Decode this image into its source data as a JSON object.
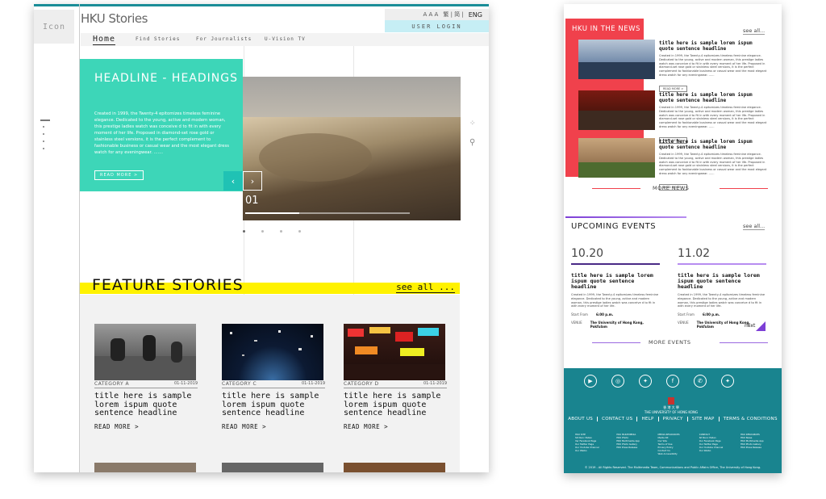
{
  "left": {
    "icon_placeholder": "Icon",
    "logo": "HKU Stories",
    "util": {
      "font_sizes": "A A A",
      "lang_alt": "繁 | 简 |",
      "lang": "ENG"
    },
    "login": "USER LOGIN",
    "nav": [
      "Home",
      "Find Stories",
      "For Journalists",
      "U-Vision TV"
    ],
    "hero": {
      "headline": "HEADLINE - HEADINGS",
      "body": "Created in 1999, the Twenty-4 epitomizes timeless feminine elegance. Dedicated to the young, active and modern woman, this prestige ladies watch was conceive d to fit in with every moment of her life. Proposed in diamond-set rose gold or stainless steel versions, it is the perfect complement to fashionable business or casual wear and the most elegant dress watch for any eveningwear. .......",
      "read_more": "READ MORE >",
      "slide_number": "01",
      "slide_progress": 0.33
    },
    "feature": {
      "title": "FEATURE STORIES",
      "see_all": "see all ..."
    },
    "cards": [
      {
        "category": "CATEGORY A",
        "date": "01-11-2019",
        "title": "title here is sample lorem ispum quote sentence headline",
        "read_more": "READ MORE >"
      },
      {
        "category": "CATEGORY C",
        "date": "01-11-2019",
        "title": "title here is sample lorem ispum quote sentence headline",
        "read_more": "READ MORE >"
      },
      {
        "category": "CATEGORY D",
        "date": "01-11-2019",
        "title": "title here is sample lorem ispum quote sentence headline",
        "read_more": "READ MORE >"
      }
    ]
  },
  "right": {
    "news_title": "HKU IN THE NEWS",
    "news_see_all": "see all...",
    "news": [
      {
        "title": "title here is sample lorem ispum quote sentence headline",
        "body": "Created in 1999, the Twenty-4 epitomizes timeless feminine elegance. Dedicated to the young, active and modern woman, this prestige ladies watch was conceive d to fit in with every moment of her life. Proposed in diamond-set rose gold or stainless steel versions, it is the perfect complement to fashionable business or casual wear and the most elegant dress watch for any eveningwear. ......",
        "read_more": "READ MORE >"
      },
      {
        "title": "title here is sample lorem ispum quote sentence headline",
        "body": "Created in 1999, the Twenty-4 epitomizes timeless feminine elegance. Dedicated to the young, active and modern woman, this prestige ladies watch was conceive d to fit in with every moment of her life. Proposed in diamond-set rose gold or stainless steel versions, it is the perfect complement to fashionable business or casual wear and the most elegant dress watch for any eveningwear. ......",
        "read_more": "READ MORE >"
      },
      {
        "title": "title here is sample lorem ispum quote sentence headline",
        "body": "Created in 1999, the Twenty-4 epitomizes timeless feminine elegance. Dedicated to the young, active and modern woman, this prestige ladies watch was conceive d to fit in with every moment of her life. Proposed in diamond-set rose gold or stainless steel versions, it is the perfect complement to fashionable business or casual wear and the most elegant dress watch for any eveningwear. ......",
        "read_more": "READ MORE >"
      }
    ],
    "more_news": "MORE NEWS",
    "events_title": "UPCOMING EVENTS",
    "events_see_all": "see all...",
    "events": [
      {
        "date": "10.20",
        "title": "title here is sample lorem ispum quote sentence headline",
        "body": "Created in 1999, the Twenty-4 epitomizes timeless feminine elegance. Dedicated to the young, active and modern woman, this prestige ladies watch was conceive d to fit in with every moment of her life.",
        "time_label": "Start From",
        "time": "6:00 p.m.",
        "venue_label": "VENUE",
        "venue": "The University of Hong Kong, Pokfulam",
        "bar_color": "#4a2a86"
      },
      {
        "date": "11.02",
        "title": "title here is sample lorem ispum quote sentence headline",
        "body": "Created in 1999, the Twenty-4 epitomizes timeless feminine elegance. Dedicated to the young, active and modern woman, this prestige ladies watch was conceive d to fit in with every moment of her life.",
        "time_label": "Start From",
        "time": "6:00 p.m.",
        "venue_label": "VENUE",
        "venue": "The University of Hong Kong, Pokfulam",
        "bar_color": "#b78df0"
      }
    ],
    "next": "next",
    "more_events": "MORE EVENTS",
    "footer": {
      "university_cn": "香 港 大 學",
      "university_en": "THE UNIVERSITY OF HONG KONG",
      "links": [
        "ABOUT US",
        "CONTACT US",
        "HELP",
        "PRIVACY",
        "SITE MAP",
        "TERMS & CONDITIONS"
      ],
      "columns": [
        [
          "HKU SITE",
          "Sit Nunc Pellen",
          "Ver Facebook Page",
          "Our Twitter Page",
          "Our Youtube Channel",
          "Our Weibo"
        ],
        [
          "HKU MULTIMEDIA",
          "HKU Photo",
          "HKU Multimedia App",
          "HKU Photo Gallery",
          "HKU Press Release"
        ],
        [
          "MEDIA RESOURCES",
          "Media Kit",
          "Our Site",
          "Terms of Use",
          "Privacy Policy",
          "Contact Us",
          "Web Accessibility"
        ],
        [
          "CONTACT",
          "Sit Nunc Pellen",
          "Our Facebook Page",
          "Our Twitter Page",
          "Our Youtube Channel",
          "Our Weibo"
        ],
        [
          "HKU RESOURCES",
          "HKU News",
          "HKU Multimedia App",
          "HKU Photo Gallery",
          "HKU Press Release"
        ]
      ],
      "copyright": "© 2019 - All Rights Reserved. The Multimedia Team, Communications and Public Affairs Office, The University of Hong Kong."
    }
  }
}
